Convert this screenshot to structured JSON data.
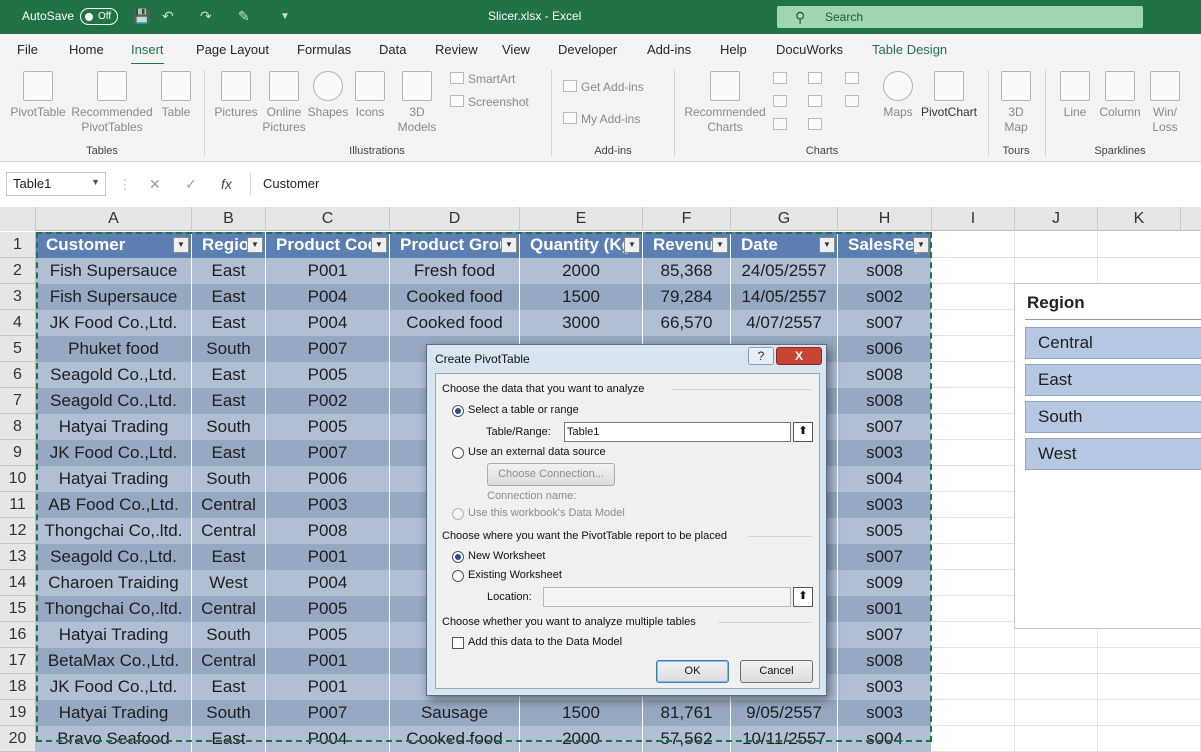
{
  "titlebar": {
    "autosave_label": "AutoSave",
    "autosave_state": "Off",
    "file_title": "Slicer.xlsx  -  Excel",
    "search_placeholder": "Search"
  },
  "tabs": [
    "File",
    "Home",
    "Insert",
    "Page Layout",
    "Formulas",
    "Data",
    "Review",
    "View",
    "Developer",
    "Add-ins",
    "Help",
    "DocuWorks",
    "Table Design"
  ],
  "active_tab": "Insert",
  "ribbon": {
    "tables": {
      "group": "Tables",
      "pivottable": "PivotTable",
      "recommended_1": "Recommended",
      "recommended_2": "PivotTables",
      "table": "Table"
    },
    "illustrations": {
      "group": "Illustrations",
      "pictures": "Pictures",
      "online_1": "Online",
      "online_2": "Pictures",
      "shapes": "Shapes",
      "icons": "Icons",
      "models_1": "3D",
      "models_2": "Models",
      "smartart": "SmartArt",
      "screenshot": "Screenshot"
    },
    "addins": {
      "group": "Add-ins",
      "get": "Get Add-ins",
      "my": "My Add-ins"
    },
    "charts": {
      "group": "Charts",
      "rec_1": "Recommended",
      "rec_2": "Charts",
      "maps": "Maps",
      "pivotchart": "PivotChart"
    },
    "tours": {
      "group": "Tours",
      "map_1": "3D",
      "map_2": "Map"
    },
    "sparklines": {
      "group": "Sparklines",
      "line": "Line",
      "column": "Column",
      "winloss_1": "Win/",
      "winloss_2": "Loss"
    }
  },
  "formula_bar": {
    "name_box": "Table1",
    "fx": "fx",
    "formula": "Customer"
  },
  "columns": [
    "A",
    "B",
    "C",
    "D",
    "E",
    "F",
    "G",
    "H",
    "I",
    "J",
    "K"
  ],
  "row_numbers": [
    "1",
    "2",
    "3",
    "4",
    "5",
    "6",
    "7",
    "8",
    "9",
    "10",
    "11",
    "12",
    "13",
    "14",
    "15",
    "16",
    "17",
    "18",
    "19",
    "20"
  ],
  "table_headers": [
    "Customer",
    "Regio",
    "Product Cod",
    "Product Grou",
    "Quantity (Kg",
    "Revenu",
    "Date",
    "SalesRep"
  ],
  "rows": [
    [
      "Fish Supersauce",
      "East",
      "P001",
      "Fresh food",
      "2000",
      "85,368",
      "24/05/2557",
      "s008"
    ],
    [
      "Fish Supersauce",
      "East",
      "P004",
      "Cooked food",
      "1500",
      "79,284",
      "14/05/2557",
      "s002"
    ],
    [
      "JK Food Co.,Ltd.",
      "East",
      "P004",
      "Cooked food",
      "3000",
      "66,570",
      "4/07/2557",
      "s007"
    ],
    [
      "Phuket food",
      "South",
      "P007",
      "",
      "",
      "",
      "",
      "s006"
    ],
    [
      "Seagold Co.,Ltd.",
      "East",
      "P005",
      "Co",
      "",
      "",
      "",
      "s008"
    ],
    [
      "Seagold Co.,Ltd.",
      "East",
      "P002",
      "Fr",
      "",
      "",
      "",
      "s008"
    ],
    [
      "Hatyai Trading",
      "South",
      "P005",
      "Co",
      "",
      "",
      "",
      "s007"
    ],
    [
      "JK Food Co.,Ltd.",
      "East",
      "P007",
      "",
      "",
      "",
      "",
      "s003"
    ],
    [
      "Hatyai Trading",
      "South",
      "P006",
      "S",
      "",
      "",
      "",
      "s004"
    ],
    [
      "AB Food Co.,Ltd.",
      "Central",
      "P003",
      "Co",
      "",
      "",
      "",
      "s003"
    ],
    [
      "Thongchai Co,.ltd.",
      "Central",
      "P008",
      "F",
      "",
      "",
      "",
      "s005"
    ],
    [
      "Seagold Co.,Ltd.",
      "East",
      "P001",
      "Fr",
      "",
      "",
      "",
      "s007"
    ],
    [
      "Charoen Traiding",
      "West",
      "P004",
      "Co",
      "",
      "",
      "",
      "s009"
    ],
    [
      "Thongchai Co,.ltd.",
      "Central",
      "P005",
      "Co",
      "",
      "",
      "",
      "s001"
    ],
    [
      "Hatyai Trading",
      "South",
      "P005",
      "Co",
      "",
      "",
      "",
      "s007"
    ],
    [
      "BetaMax Co.,Ltd.",
      "Central",
      "P001",
      "Fr",
      "",
      "",
      "",
      "s008"
    ],
    [
      "JK Food Co.,Ltd.",
      "East",
      "P001",
      "Fr",
      "",
      "",
      "",
      "s003"
    ],
    [
      "Hatyai Trading",
      "South",
      "P007",
      "Sausage",
      "1500",
      "81,761",
      "9/05/2557",
      "s003"
    ],
    [
      "Bravo Seafood",
      "East",
      "P004",
      "Cooked food",
      "2000",
      "57,562",
      "10/11/2557",
      "s004"
    ]
  ],
  "slicer": {
    "title": "Region",
    "items": [
      "Central",
      "East",
      "South",
      "West"
    ]
  },
  "dialog": {
    "title": "Create PivotTable",
    "help": "?",
    "close": "X",
    "section1": "Choose the data that you want to analyze",
    "opt_table": "Select a table or range",
    "range_label": "Table/Range:",
    "range_value": "Table1",
    "opt_external": "Use an external data source",
    "choose_connection": "Choose Connection...",
    "connection_name": "Connection name:",
    "opt_datamodel": "Use this workbook's Data Model",
    "section2": "Choose where you want the PivotTable report to be placed",
    "opt_new": "New Worksheet",
    "opt_existing": "Existing Worksheet",
    "location_label": "Location:",
    "location_value": "",
    "section3": "Choose whether you want to analyze multiple tables",
    "add_datamodel": "Add this data to the Data Model",
    "ok": "OK",
    "cancel": "Cancel"
  }
}
